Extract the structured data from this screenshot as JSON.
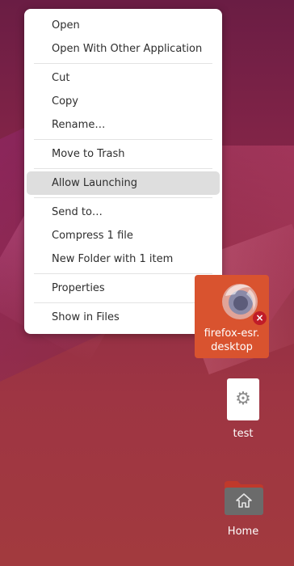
{
  "context_menu": {
    "items": [
      {
        "label": "Open"
      },
      {
        "label": "Open With Other Application"
      },
      {
        "label": "Cut"
      },
      {
        "label": "Copy"
      },
      {
        "label": "Rename…"
      },
      {
        "label": "Move to Trash"
      },
      {
        "label": "Allow Launching",
        "selected": true
      },
      {
        "label": "Send to…"
      },
      {
        "label": "Compress 1 file"
      },
      {
        "label": "New Folder with 1 item"
      },
      {
        "label": "Properties"
      },
      {
        "label": "Show in Files"
      }
    ]
  },
  "desktop_icons": {
    "firefox": {
      "label_line1": "firefox-esr.",
      "label_line2": "desktop",
      "icon": "firefox-icon",
      "badge": "×"
    },
    "test": {
      "label": "test",
      "icon": "gear-icon"
    },
    "home": {
      "label": "Home",
      "icon": "home-folder-icon"
    }
  },
  "colors": {
    "selection": "#d9532f",
    "menu_highlight": "#dedede",
    "badge": "#c01c28"
  }
}
